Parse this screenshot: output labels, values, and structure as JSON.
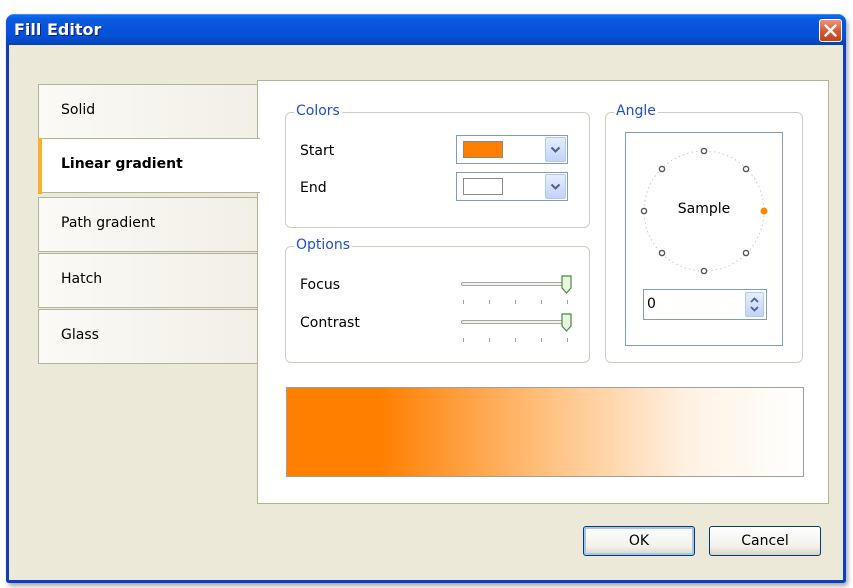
{
  "window": {
    "title": "Fill Editor"
  },
  "tabs": [
    {
      "label": "Solid"
    },
    {
      "label": "Linear gradient"
    },
    {
      "label": "Path gradient"
    },
    {
      "label": "Hatch"
    },
    {
      "label": "Glass"
    }
  ],
  "colors": {
    "group_label": "Colors",
    "start_label": "Start",
    "end_label": "End",
    "start_color": "#ff7f00",
    "end_color": "#ffffff"
  },
  "options": {
    "group_label": "Options",
    "focus_label": "Focus",
    "contrast_label": "Contrast",
    "focus_value": 100,
    "contrast_value": 100
  },
  "angle": {
    "group_label": "Angle",
    "sample_text": "Sample",
    "value": "0"
  },
  "preview": {
    "from_color": "#ff7f00",
    "to_color": "#ffffff"
  },
  "buttons": {
    "ok": "OK",
    "cancel": "Cancel"
  }
}
